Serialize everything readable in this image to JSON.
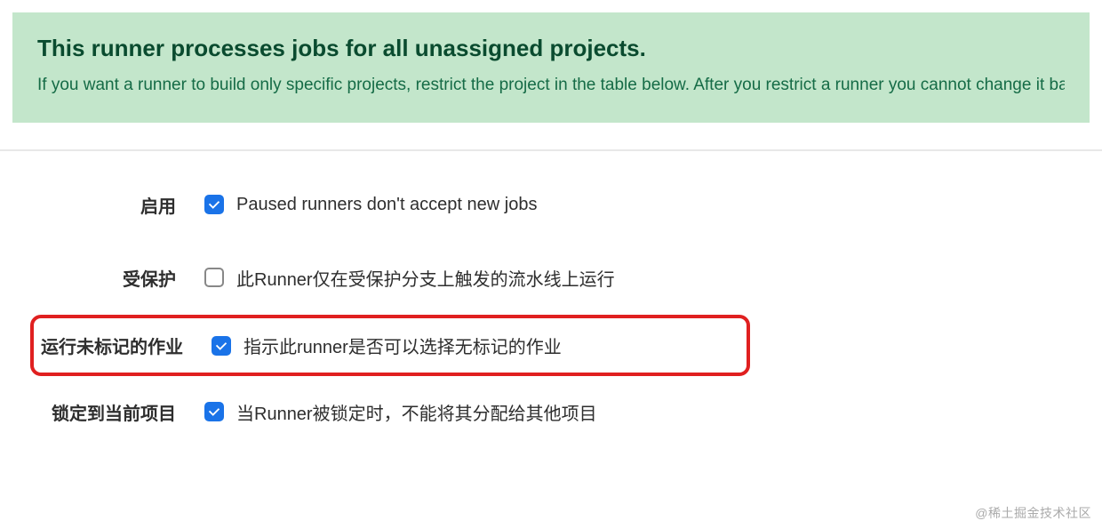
{
  "alert": {
    "title": "This runner processes jobs for all unassigned projects.",
    "description": "If you want a runner to build only specific projects, restrict the project in the table below. After you restrict a runner you cannot change it back to a shared runner."
  },
  "form": {
    "enable": {
      "label": "启用",
      "checkbox_label": "Paused runners don't accept new jobs",
      "checked": true
    },
    "protected": {
      "label": "受保护",
      "checkbox_label": "此Runner仅在受保护分支上触发的流水线上运行",
      "checked": false
    },
    "untagged": {
      "label": "运行未标记的作业",
      "checkbox_label": "指示此runner是否可以选择无标记的作业",
      "checked": true
    },
    "locked": {
      "label": "锁定到当前项目",
      "checkbox_label": "当Runner被锁定时，不能将其分配给其他项目",
      "checked": true
    }
  },
  "watermark": "@稀土掘金技术社区"
}
